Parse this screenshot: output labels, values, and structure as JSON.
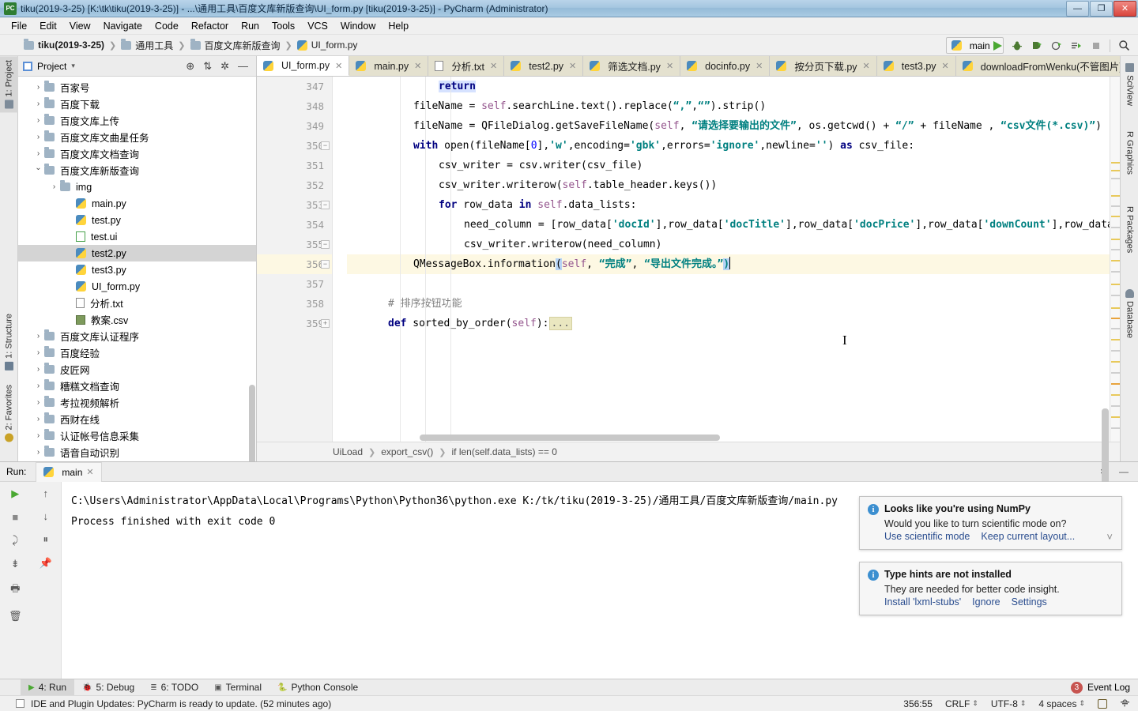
{
  "window": {
    "title": "tiku(2019-3-25) [K:\\tk\\tiku(2019-3-25)] - ...\\通用工具\\百度文库新版查询\\UI_form.py [tiku(2019-3-25)] - PyCharm (Administrator)",
    "app_icon": "PC",
    "minimize": "—",
    "maximize": "❐",
    "close": "✕"
  },
  "menu": [
    {
      "label": "File"
    },
    {
      "label": "Edit"
    },
    {
      "label": "View"
    },
    {
      "label": "Navigate"
    },
    {
      "label": "Code"
    },
    {
      "label": "Refactor"
    },
    {
      "label": "Run"
    },
    {
      "label": "Tools"
    },
    {
      "label": "VCS"
    },
    {
      "label": "Window"
    },
    {
      "label": "Help"
    }
  ],
  "breadcrumb": [
    {
      "label": "tiku(2019-3-25)",
      "icon": "folder-icon"
    },
    {
      "label": "通用工具",
      "icon": "folder-icon"
    },
    {
      "label": "百度文库新版查询",
      "icon": "folder-icon"
    },
    {
      "label": "UI_form.py",
      "icon": "python-file-icon"
    }
  ],
  "run_config": {
    "name": "main",
    "chevron": "˅"
  },
  "toolbar_icons": [
    {
      "name": "run-icon",
      "glyph": "▶"
    },
    {
      "name": "debug-icon",
      "glyph": "🐞"
    },
    {
      "name": "run-coverage-icon",
      "glyph": "↷"
    },
    {
      "name": "profile-icon",
      "glyph": "◔"
    },
    {
      "name": "attach-icon",
      "glyph": "⇥"
    },
    {
      "name": "stop-icon",
      "glyph": "■"
    },
    {
      "name": "search-icon",
      "glyph": "🔍"
    }
  ],
  "left_strip": [
    {
      "label": "1: Project",
      "active": true
    },
    {
      "label": "1: Structure",
      "active": false
    },
    {
      "label": "2: Favorites",
      "active": false
    }
  ],
  "right_strip": [
    {
      "label": "SciView"
    },
    {
      "label": "R Graphics"
    },
    {
      "label": "R Packages"
    },
    {
      "label": "Database"
    }
  ],
  "project_panel": {
    "title": "Project",
    "chevron": "▾",
    "actions": [
      {
        "name": "locate-icon",
        "glyph": "⊕"
      },
      {
        "name": "collapse-all-icon",
        "glyph": "⇅"
      },
      {
        "name": "settings-gear-icon",
        "glyph": "✲"
      },
      {
        "name": "hide-icon",
        "glyph": "—"
      }
    ],
    "tree": [
      {
        "label": "百家号",
        "icon": "folder-icon",
        "indent": 1,
        "state": "closed",
        "selected": false
      },
      {
        "label": "百度下载",
        "icon": "folder-icon",
        "indent": 1,
        "state": "closed",
        "selected": false
      },
      {
        "label": "百度文库上传",
        "icon": "folder-icon",
        "indent": 1,
        "state": "closed",
        "selected": false
      },
      {
        "label": "百度文库文曲星任务",
        "icon": "folder-icon",
        "indent": 1,
        "state": "closed",
        "selected": false
      },
      {
        "label": "百度文库文档查询",
        "icon": "folder-icon",
        "indent": 1,
        "state": "closed",
        "selected": false
      },
      {
        "label": "百度文库新版查询",
        "icon": "folder-icon",
        "indent": 1,
        "state": "open",
        "selected": false
      },
      {
        "label": "img",
        "icon": "folder-icon",
        "indent": 2,
        "state": "closed",
        "selected": false
      },
      {
        "label": "main.py",
        "icon": "python-file-icon",
        "indent": 3,
        "state": "leaf",
        "selected": false
      },
      {
        "label": "test.py",
        "icon": "python-file-icon",
        "indent": 3,
        "state": "leaf",
        "selected": false
      },
      {
        "label": "test.ui",
        "icon": "qt-ui-file-icon",
        "indent": 3,
        "state": "leaf",
        "selected": false
      },
      {
        "label": "test2.py",
        "icon": "python-file-icon",
        "indent": 3,
        "state": "leaf",
        "selected": true
      },
      {
        "label": "test3.py",
        "icon": "python-file-icon",
        "indent": 3,
        "state": "leaf",
        "selected": false
      },
      {
        "label": "UI_form.py",
        "icon": "python-file-icon",
        "indent": 3,
        "state": "leaf",
        "selected": false
      },
      {
        "label": "分析.txt",
        "icon": "text-file-icon",
        "indent": 3,
        "state": "leaf",
        "selected": false
      },
      {
        "label": "教案.csv",
        "icon": "csv-file-icon",
        "indent": 3,
        "state": "leaf",
        "selected": false
      },
      {
        "label": "百度文库认证程序",
        "icon": "folder-icon",
        "indent": 1,
        "state": "closed",
        "selected": false
      },
      {
        "label": "百度经验",
        "icon": "folder-icon",
        "indent": 1,
        "state": "closed",
        "selected": false
      },
      {
        "label": "皮匠网",
        "icon": "folder-icon",
        "indent": 1,
        "state": "closed",
        "selected": false
      },
      {
        "label": "糟糕文档查询",
        "icon": "folder-icon",
        "indent": 1,
        "state": "closed",
        "selected": false
      },
      {
        "label": "考拉视频解析",
        "icon": "folder-icon",
        "indent": 1,
        "state": "closed",
        "selected": false
      },
      {
        "label": "西财在线",
        "icon": "folder-icon",
        "indent": 1,
        "state": "closed",
        "selected": false
      },
      {
        "label": "认证帐号信息采集",
        "icon": "folder-icon",
        "indent": 1,
        "state": "closed",
        "selected": false
      },
      {
        "label": "语音自动识别",
        "icon": "folder-icon",
        "indent": 1,
        "state": "closed",
        "selected": false
      }
    ]
  },
  "editor_tabs": [
    {
      "label": "UI_form.py",
      "icon": "python-file-icon",
      "active": true
    },
    {
      "label": "main.py",
      "icon": "python-file-icon",
      "active": false
    },
    {
      "label": "分析.txt",
      "icon": "text-file-icon",
      "active": false
    },
    {
      "label": "test2.py",
      "icon": "python-file-icon",
      "active": false
    },
    {
      "label": "筛选文档.py",
      "icon": "python-file-icon",
      "active": false
    },
    {
      "label": "docinfo.py",
      "icon": "python-file-icon",
      "active": false
    },
    {
      "label": "按分页下载.py",
      "icon": "python-file-icon",
      "active": false
    },
    {
      "label": "test3.py",
      "icon": "python-file-icon",
      "active": false
    },
    {
      "label": "downloadFromWenku(不管图片).py",
      "icon": "python-file-icon",
      "active": false
    }
  ],
  "editor": {
    "first_line": 347,
    "current_line": 356,
    "lines": [
      {
        "n": 347,
        "fold": "none"
      },
      {
        "n": 348,
        "fold": "none"
      },
      {
        "n": 349,
        "fold": "none"
      },
      {
        "n": 350,
        "fold": "end"
      },
      {
        "n": 351,
        "fold": "none"
      },
      {
        "n": 352,
        "fold": "none"
      },
      {
        "n": 353,
        "fold": "end"
      },
      {
        "n": 354,
        "fold": "none"
      },
      {
        "n": 355,
        "fold": "end"
      },
      {
        "n": 356,
        "fold": "end"
      },
      {
        "n": 357,
        "fold": "none"
      },
      {
        "n": 358,
        "fold": "none"
      },
      {
        "n": 359,
        "fold": "plus"
      }
    ],
    "code_text": [
      "            return",
      "        fileName = self.searchLine.text().replace(“,”,“”).strip()",
      "        fileName = QFileDialog.getSaveFileName(self, “请选择要输出的文件”, os.getcwd() + “/” + fileName , “csv文件(*.csv)”)",
      "        with open(fileName[0],'w',encoding='gbk',errors='ignore',newline='') as csv_file:",
      "            csv_writer = csv.writer(csv_file)",
      "            csv_writer.writerow(self.table_header.keys())",
      "            for row_data in self.data_lists:",
      "                need_column = [row_data['docId'],row_data['docTitle'],row_data['docPrice'],row_data['downCount'],row_data['vi",
      "                csv_writer.writerow(need_column)",
      "        QMessageBox.information(self, “完成”, “导出文件完成。”)",
      "",
      "    # 排序按钮功能",
      "    def sorted_by_order(self):..."
    ]
  },
  "editor_breadcrumb": [
    {
      "label": "UiLoad"
    },
    {
      "label": "export_csv()"
    },
    {
      "label": "if len(self.data_lists) == 0"
    }
  ],
  "run_panel": {
    "run_label": "Run:",
    "tab_label": "main",
    "tab_close": "✕",
    "gutter_icons": [
      {
        "name": "rerun-icon",
        "glyph": "▶"
      },
      {
        "name": "scroll-up-icon",
        "glyph": "↑"
      },
      {
        "name": "stop-icon",
        "glyph": "■"
      },
      {
        "name": "scroll-down-icon",
        "glyph": "↓"
      },
      {
        "name": "pause-icon",
        "glyph": "⏸"
      },
      {
        "name": "soft-wrap-icon",
        "glyph": "⤸"
      },
      {
        "name": "scroll-to-end-icon",
        "glyph": "⇟"
      },
      {
        "name": "print-icon",
        "glyph": "🖶"
      },
      {
        "name": "pin-icon",
        "glyph": "📌"
      },
      {
        "name": "clear-all-icon",
        "glyph": "🗑"
      }
    ],
    "header_right": [
      {
        "name": "settings-gear-icon",
        "glyph": "✲"
      },
      {
        "name": "hide-icon",
        "glyph": "—"
      }
    ],
    "console_lines": [
      "C:\\Users\\Administrator\\AppData\\Local\\Programs\\Python\\Python36\\python.exe K:/tk/tiku(2019-3-25)/通用工具/百度文库新版查询/main.py",
      "",
      "Process finished with exit code 0"
    ]
  },
  "notifications": [
    {
      "title": "Looks like you're using NumPy",
      "subtitle": "Would you like to turn scientific mode on?",
      "links": [
        "Use scientific mode",
        "Keep current layout..."
      ],
      "chevron": "˅",
      "has_chevron": true
    },
    {
      "title": "Type hints are not installed",
      "subtitle": "They are needed for better code insight.",
      "links": [
        "Install 'lxml-stubs'",
        "Ignore",
        "Settings"
      ],
      "chevron": "",
      "has_chevron": false
    }
  ],
  "bottom_tabs": [
    {
      "label": "4: Run",
      "glyph": "▶",
      "active": true
    },
    {
      "label": "5: Debug",
      "glyph": "🐞",
      "active": false
    },
    {
      "label": "6: TODO",
      "glyph": "≣",
      "active": false
    },
    {
      "label": "Terminal",
      "glyph": "▣",
      "active": false
    },
    {
      "label": "Python Console",
      "glyph": "🐍",
      "active": false
    }
  ],
  "event_log": {
    "label": "Event Log",
    "count": "3"
  },
  "statusbar": {
    "message": "IDE and Plugin Updates: PyCharm is ready to update. (52 minutes ago)",
    "caret_position": "356:55",
    "line_separator": "CRLF",
    "encoding": "UTF-8",
    "indent": "4 spaces",
    "lock_icon": "lock-icon",
    "inspection_icon": "inspection-icon"
  },
  "colors": {
    "title_gradient_top": "#b9d4ea",
    "accent_blue": "#3c8fd0",
    "string_green": "#008080",
    "keyword_navy": "#000080",
    "selected_row": "#d4d4d4",
    "current_line": "#fdf8e3",
    "badge_red": "#c75450"
  }
}
